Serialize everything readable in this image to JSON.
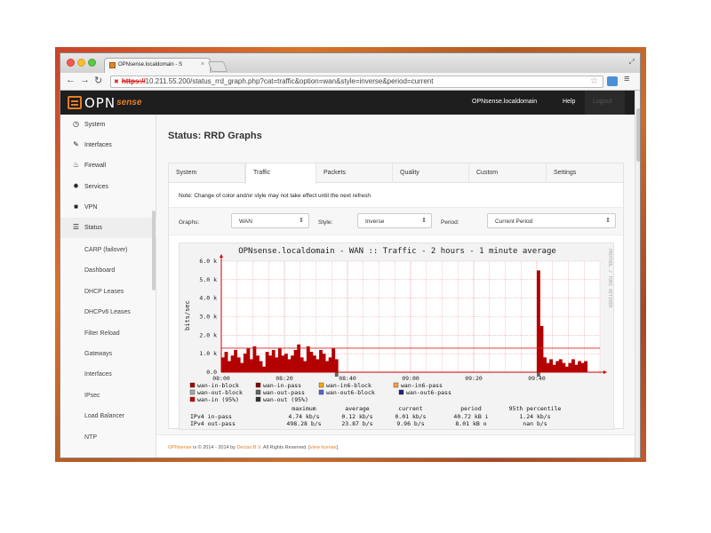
{
  "browser": {
    "tab_title": "OPNsense.localdomain - S",
    "tab_close": "×",
    "url_scheme": "https://",
    "url_rest": "10.211.55.200/status_rrd_graph.php?cat=traffic&option=wan&style=inverse&period=current"
  },
  "header": {
    "logo_opn": "OPN",
    "logo_sense": "sense",
    "hostname": "OPNsense.localdomain",
    "help": "Help",
    "logout": "Logout"
  },
  "sidebar": {
    "items": [
      {
        "label": "System",
        "icon": "clock-icon"
      },
      {
        "label": "Interfaces",
        "icon": "wrench-icon"
      },
      {
        "label": "Firewall",
        "icon": "flame-icon"
      },
      {
        "label": "Services",
        "icon": "cog-icon"
      },
      {
        "label": "VPN",
        "icon": "lock-icon"
      },
      {
        "label": "Status",
        "icon": "list-icon"
      }
    ],
    "status_sub": [
      "CARP (failover)",
      "Dashboard",
      "DHCP Leases",
      "DHCPv6 Leases",
      "Filter Reload",
      "Gateways",
      "Interfaces",
      "IPsec",
      "Load Balancer",
      "NTP"
    ]
  },
  "page": {
    "title": "Status: RRD Graphs",
    "tabs": [
      "System",
      "Traffic",
      "Packets",
      "Quality",
      "Custom",
      "Settings"
    ],
    "active_tab": "Traffic",
    "note": "Note: Change of color and/or style may not take effect until the next refresh",
    "filters": {
      "graphs_label": "Graphs:",
      "graphs_value": "WAN",
      "style_label": "Style:",
      "style_value": "Inverse",
      "period_label": "Period:",
      "period_value": "Current Period"
    }
  },
  "chart_data": {
    "type": "bar",
    "title": "OPNsense.localdomain - WAN :: Traffic - 2 hours - 1 minute average",
    "ylabel": "bits/sec",
    "side_label": "PROTOOL / TOBI OETIKER",
    "y_ticks": [
      "6.0 k",
      "5.0 k",
      "4.0 k",
      "3.0 k",
      "2.0 k",
      "1.0 k",
      "0.0"
    ],
    "x_ticks": [
      "08:00",
      "08:20",
      "08:40",
      "09:00",
      "09:20",
      "09:40"
    ],
    "ylim": [
      0,
      6000
    ],
    "grid": true,
    "series_in_pass": {
      "name": "wan-in-pass",
      "x_minutes": [
        0,
        1,
        2,
        3,
        4,
        5,
        6,
        7,
        8,
        9,
        10,
        11,
        12,
        13,
        14,
        15,
        16,
        17,
        18,
        19,
        20,
        21,
        22,
        23,
        24,
        25,
        26,
        27,
        28,
        29,
        30,
        31,
        32,
        33,
        34,
        35,
        36,
        100,
        101,
        102,
        103,
        104,
        105,
        106,
        107,
        108,
        109,
        110,
        111,
        112,
        113,
        114,
        115
      ],
      "values": [
        800,
        1100,
        600,
        900,
        1200,
        800,
        500,
        1000,
        1300,
        700,
        1400,
        900,
        600,
        300,
        1100,
        900,
        1200,
        800,
        1300,
        900,
        1000,
        700,
        900,
        1200,
        1500,
        800,
        600,
        1400,
        1100,
        900,
        700,
        1200,
        1000,
        600,
        800,
        1300,
        700,
        5500,
        2500,
        800,
        500,
        700,
        400,
        600,
        700,
        500,
        300,
        500,
        700,
        400,
        600,
        500,
        600
      ]
    },
    "threshold_95": 1300,
    "legend": [
      {
        "label": "wan-in-block",
        "color": "#aa0000"
      },
      {
        "label": "wan-in-pass",
        "color": "#8b0000"
      },
      {
        "label": "wan-in6-block",
        "color": "#ffa500"
      },
      {
        "label": "wan-in6-pass",
        "color": "#ffa040"
      },
      {
        "label": "wan-out-block",
        "color": "#aaaaaa"
      },
      {
        "label": "wan-out-pass",
        "color": "#666666"
      },
      {
        "label": "wan-out6-block",
        "color": "#6060d0"
      },
      {
        "label": "wan-out6-pass",
        "color": "#202080"
      },
      {
        "label": "wan-in (95%)",
        "color": "#cc0000"
      },
      {
        "label": "wan-out (95%)",
        "color": "#333333"
      }
    ],
    "stats_header": [
      "",
      "maximum",
      "average",
      "current",
      "period",
      "95th percentile"
    ],
    "stats_rows": [
      [
        "IPv4 in-pass",
        "4.74 kb/s",
        "0.12 kb/s",
        "0.01 kb/s",
        "40.72 kB i",
        "1.24 kb/s"
      ],
      [
        "IPv4 out-pass",
        "498.28  b/s",
        "23.87  b/s",
        "9.96  b/s",
        "8.01 kB o",
        "nan  b/s"
      ]
    ]
  },
  "footer": {
    "brand": "OPNsense",
    "text1": " is © 2014 - 2014 by ",
    "company": "Deciso B.V.",
    "text2": " All Rights Reserved. [",
    "license": "view license",
    "text3": "]"
  }
}
